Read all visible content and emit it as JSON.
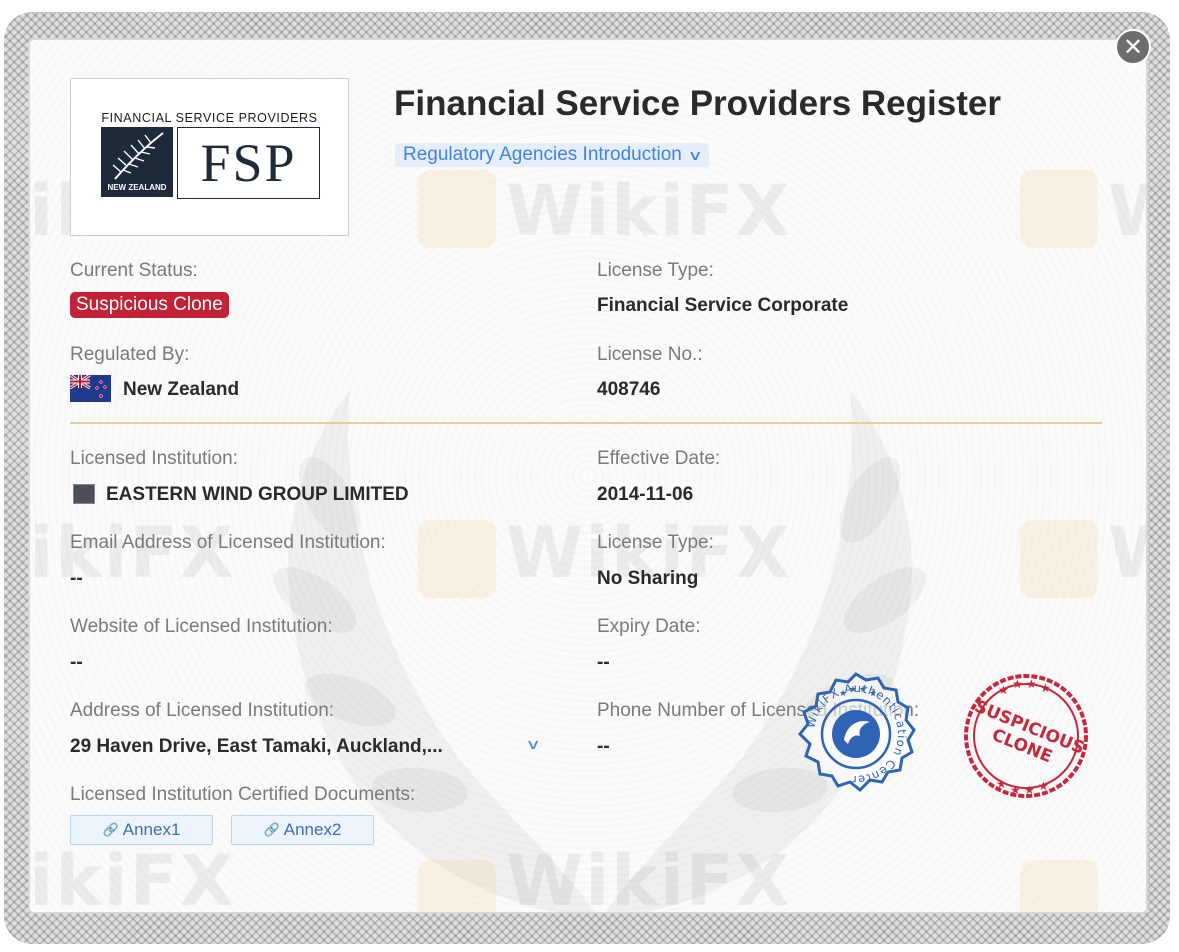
{
  "header": {
    "title": "Financial Service Providers Register",
    "regulatory_link": "Regulatory Agencies Introduction"
  },
  "logo": {
    "top_text": "FINANCIAL SERVICE PROVIDERS",
    "abbr": "FSP",
    "country_mark": "NEW ZEALAND"
  },
  "fields": {
    "current_status_label": "Current Status:",
    "current_status_value": "Suspicious Clone",
    "license_type_label": "License Type:",
    "license_type_value": "Financial Service Corporate",
    "regulated_by_label": "Regulated By:",
    "regulated_by_value": "New Zealand",
    "license_no_label": "License No.:",
    "license_no_value": "408746",
    "licensed_institution_label": "Licensed Institution:",
    "licensed_institution_value": "EASTERN WIND GROUP LIMITED",
    "effective_date_label": "Effective Date:",
    "effective_date_value": "2014-11-06",
    "email_label": "Email Address of Licensed Institution:",
    "email_value": "--",
    "license_type2_label": "License Type:",
    "license_type2_value": "No Sharing",
    "website_label": "Website of Licensed Institution:",
    "website_value": "--",
    "expiry_label": "Expiry Date:",
    "expiry_value": "--",
    "address_label": "Address of Licensed Institution:",
    "address_value": "29 Haven Drive, East Tamaki, Auckland,...",
    "phone_label": "Phone Number of Licensed Institution:",
    "phone_value": "--",
    "docs_label": "Licensed Institution Certified Documents:"
  },
  "documents": [
    "Annex1",
    "Annex2"
  ],
  "stamps": {
    "auth_text": "WikiFX Authentication Center",
    "clone_line1": "SUSPICIOUS",
    "clone_line2": "CLONE"
  },
  "watermark": "WikiFX",
  "colors": {
    "status_badge": "#c32236",
    "link": "#3f82e6",
    "divider": "#e1cf9e",
    "auth_stamp": "#2f63b3",
    "clone_stamp": "#c8283b"
  }
}
